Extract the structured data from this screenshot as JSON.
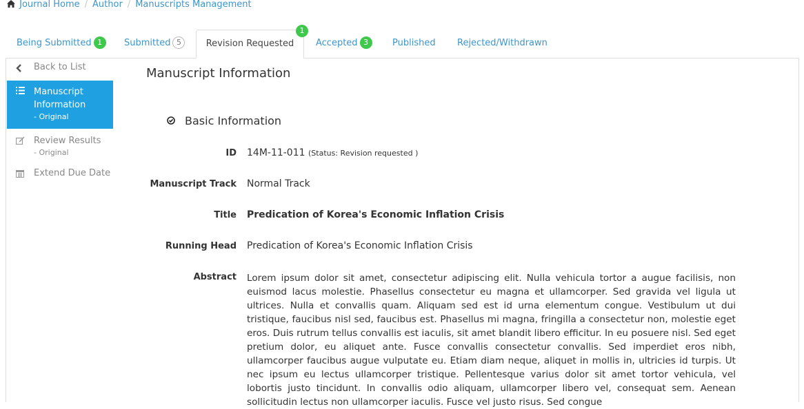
{
  "breadcrumb": [
    "Journal Home",
    "Author",
    "Manuscripts Management"
  ],
  "tabs": [
    {
      "label": "Being Submitted",
      "badge": "1"
    },
    {
      "label": "Submitted",
      "badge": "5"
    },
    {
      "label": "Revision Requested",
      "badge": "1"
    },
    {
      "label": "Accepted",
      "badge": "3"
    },
    {
      "label": "Published"
    },
    {
      "label": "Rejected/Withdrawn"
    }
  ],
  "sidebar": {
    "back": "Back to List",
    "manuscript_info": "Manuscript Information",
    "manuscript_info_sub": "- Original",
    "review_results": "Review Results",
    "review_results_sub": "- Original",
    "extend_due": "Extend Due Date"
  },
  "main": {
    "title": "Manuscript Information",
    "section": "Basic Information"
  },
  "fields": {
    "id_label": "ID",
    "id_value": "14M-11-011",
    "id_status": "(Status: Revision requested )",
    "track_label": "Manuscript Track",
    "track_value": "Normal Track",
    "title_label": "Title",
    "title_value": "Predication of Korea's Economic Inflation Crisis",
    "running_head_label": "Running Head",
    "running_head_value": "Predication of Korea's Economic Inflation Crisis",
    "abstract_label": "Abstract",
    "abstract_value": "Lorem ipsum dolor sit amet, consectetur adipiscing elit. Nulla vehicula tortor a augue facilisis, non euismod lacus molestie. Phasellus consectetur eu magna et ullamcorper. Sed gravida vel ligula ut ultrices. Nulla et convallis quam. Aliquam sed est id urna elementum congue. Vestibulum ut dui tristique, faucibus nisl sed, faucibus est. Phasellus mi magna, fringilla a consectetur non, molestie eget eros. Duis rutrum tellus convallis est iaculis, sit amet blandit libero efficitur. In eu posuere nisl. Sed eget pretium dolor, eu aliquet ante. Fusce convallis consectetur convallis. Sed imperdiet eros nibh, ullamcorper faucibus augue vulputate eu. Etiam diam neque, aliquet in mollis in, ultricies id turpis. Ut nec ipsum eu lectus ullamcorper tristique. Pellentesque varius dolor sit amet tortor vehicula, vel lobortis justo tincidunt. In convallis odio aliquam, ullamcorper libero vel, consequat sem. Aenean sollicitudin lectus non ullamcorper iaculis. Fusce vel justo risus. Sed congue"
  },
  "colors": {
    "link": "#3a96cc",
    "active": "#1fa0e0",
    "badge": "#3fc94c"
  },
  "icons": {
    "home": "home-icon",
    "back": "chevron-left-icon",
    "list": "list-icon",
    "edit": "edit-icon",
    "calendar": "calendar-icon",
    "check": "check-circle-icon"
  }
}
